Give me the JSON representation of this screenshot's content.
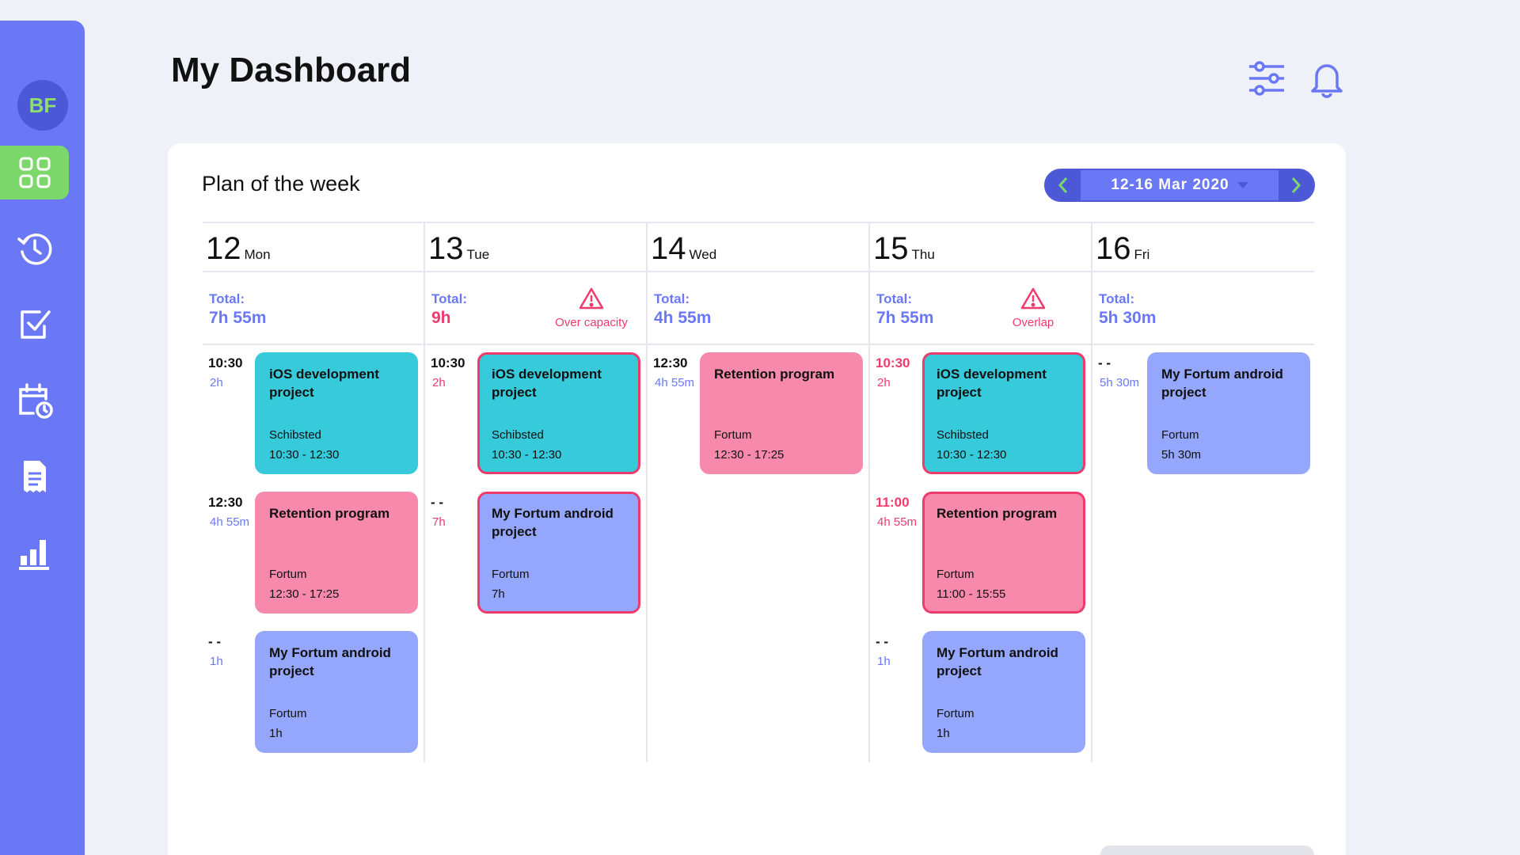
{
  "user": {
    "initials": "BF"
  },
  "header": {
    "title": "My Dashboard"
  },
  "sidebar": {
    "items": [
      {
        "name": "dashboard",
        "icon": "grid-icon",
        "active": true
      },
      {
        "name": "history",
        "icon": "clock-history-icon"
      },
      {
        "name": "tasks",
        "icon": "checklist-icon"
      },
      {
        "name": "schedule",
        "icon": "calendar-clock-icon"
      },
      {
        "name": "documents",
        "icon": "document-icon"
      },
      {
        "name": "reports",
        "icon": "bar-chart-icon"
      }
    ]
  },
  "plan": {
    "title": "Plan of the week",
    "range": "12-16 Mar 2020",
    "total_label": "Total:",
    "days": [
      {
        "num": "12",
        "name": "Mon",
        "total": "7h 55m",
        "total_red": false,
        "warning": "",
        "slots": [
          {
            "time": "10:30",
            "dur": "2h",
            "time_red": false,
            "dur_red": false,
            "task": {
              "title": "iOS development project",
              "client": "Schibsted",
              "time": "10:30  - 12:30",
              "color": "cyan",
              "flag": false
            }
          },
          {
            "time": "12:30",
            "dur": "4h 55m",
            "time_red": false,
            "dur_red": false,
            "task": {
              "title": "Retention program",
              "client": "Fortum",
              "time": "12:30  - 17:25",
              "color": "pink",
              "flag": false
            }
          },
          {
            "time": "- -",
            "dur": "1h",
            "time_red": false,
            "dur_red": false,
            "task": {
              "title": "My Fortum android project",
              "client": "Fortum",
              "time": "1h",
              "color": "blue",
              "flag": false
            }
          }
        ]
      },
      {
        "num": "13",
        "name": "Tue",
        "total": "9h",
        "total_red": true,
        "warning": "Over capacity",
        "slots": [
          {
            "time": "10:30",
            "dur": "2h",
            "time_red": false,
            "dur_red": true,
            "task": {
              "title": "iOS development project",
              "client": "Schibsted",
              "time": "10:30  - 12:30",
              "color": "cyan",
              "flag": true
            }
          },
          {
            "time": "- -",
            "dur": "7h",
            "time_red": false,
            "dur_red": true,
            "task": {
              "title": "My Fortum android project",
              "client": "Fortum",
              "time": "7h",
              "color": "blue",
              "flag": true
            }
          }
        ]
      },
      {
        "num": "14",
        "name": "Wed",
        "total": "4h 55m",
        "total_red": false,
        "warning": "",
        "slots": [
          {
            "time": "12:30",
            "dur": "4h 55m",
            "time_red": false,
            "dur_red": false,
            "task": {
              "title": "Retention program",
              "client": "Fortum",
              "time": "12:30  - 17:25",
              "color": "pink",
              "flag": false
            }
          }
        ]
      },
      {
        "num": "15",
        "name": "Thu",
        "total": "7h 55m",
        "total_red": false,
        "warning": "Overlap",
        "slots": [
          {
            "time": "10:30",
            "dur": "2h",
            "time_red": true,
            "dur_red": true,
            "task": {
              "title": "iOS development project",
              "client": "Schibsted",
              "time": "10:30  - 12:30",
              "color": "cyan",
              "flag": true
            }
          },
          {
            "time": "11:00",
            "dur": "4h 55m",
            "time_red": true,
            "dur_red": true,
            "task": {
              "title": "Retention program",
              "client": "Fortum",
              "time": "11:00  - 15:55",
              "color": "pink",
              "flag": true
            }
          },
          {
            "time": "- -",
            "dur": "1h",
            "time_red": false,
            "dur_red": false,
            "task": {
              "title": "My Fortum android project",
              "client": "Fortum",
              "time": "1h",
              "color": "blue",
              "flag": false
            }
          }
        ]
      },
      {
        "num": "16",
        "name": "Fri",
        "total": "5h 30m",
        "total_red": false,
        "warning": "",
        "slots": [
          {
            "time": "- -",
            "dur": "5h 30m",
            "time_red": false,
            "dur_red": false,
            "task": {
              "title": "My Fortum android project",
              "client": "Fortum",
              "time": "5h 30m",
              "color": "blue",
              "flag": false
            }
          }
        ]
      }
    ]
  },
  "colors": {
    "accent": "#6b78f5",
    "accent_dark": "#4c58d6",
    "active_nav": "#7cd86a",
    "warning": "#ef3a6c",
    "cyan": "#36cadb",
    "pink": "#f789ad",
    "blue": "#94a7fd"
  }
}
